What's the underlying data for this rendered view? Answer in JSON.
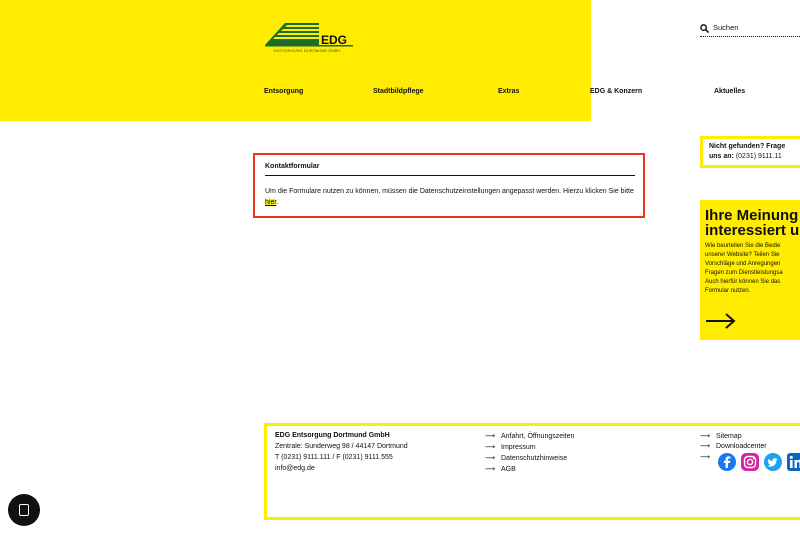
{
  "header": {
    "logo": {
      "name": "EDG",
      "subtitle": "ENTSORGUNG DORTMUND GMBH"
    },
    "nav": [
      "Entsorgung",
      "Stadtbildpflege",
      "Extras",
      "EDG & Konzern",
      "Aktuelles"
    ],
    "search": {
      "label": "Suchen"
    }
  },
  "contact": {
    "title": "Kontaktformular",
    "text": "Um die Formulare nutzen zu können, müssen die Datenschutzeinstellungen angepasst werden. Hierzu klicken Sie bitte",
    "link": "hier",
    "after": "."
  },
  "sidebar": {
    "notfound": {
      "line1": "Nicht gefunden? Frage",
      "line2_label": "uns an:",
      "line2_value": " (0231) 9111.11"
    },
    "opinion": {
      "title1": "Ihre Meinung",
      "title2": "interessiert u",
      "lines": [
        "Wie beurteilen Sie die Bedie",
        "unserer Website? Teilen Sie",
        "Vorschläge und Anregungen",
        "Fragen zum Dienstleistungsa",
        "Auch hierfür können Sie das",
        "Formular nutzen."
      ]
    }
  },
  "footer": {
    "company": "EDG Entsorgung Dortmund GmbH",
    "address": "Zentrale: Sunderweg 98 / 44147 Dortmund",
    "phone": "T (0231) 9111.111 / F (0231) 9111.555",
    "email": "info@edg.de",
    "links_mid": [
      "Anfahrt, Öffnungszeiten",
      "Impressum",
      "Datenschutzhinweise",
      "AGB"
    ],
    "links_right": [
      "Sitemap",
      "Downloadcenter"
    ],
    "arrow": "⟶",
    "social": [
      "facebook-icon",
      "instagram-icon",
      "twitter-icon",
      "linkedin-icon"
    ]
  },
  "colors": {
    "brand_yellow": "#ffec00",
    "brand_green": "#1a6e2a",
    "alert_red": "#e8341c"
  }
}
